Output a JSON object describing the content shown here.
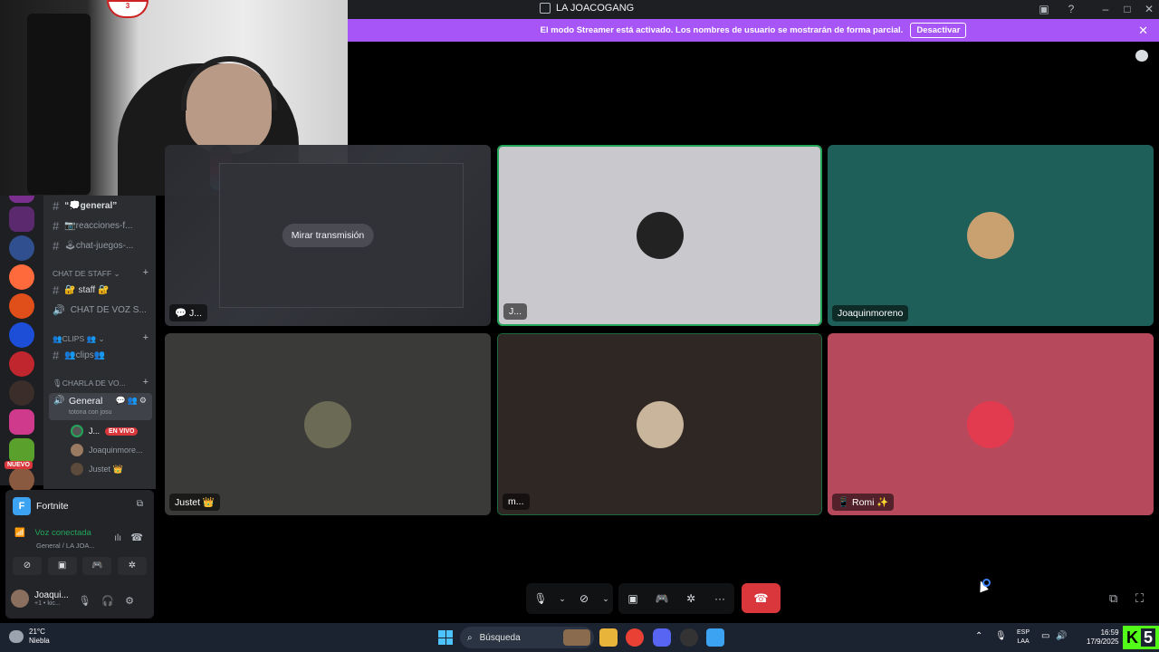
{
  "window": {
    "title": "LA JOACOGANG"
  },
  "banner": {
    "message": "El modo Streamer está activado. Los nombres de usuario se mostrarán de forma parcial.",
    "button": "Desactivar"
  },
  "webcam": {
    "logo_text": "3"
  },
  "channels": {
    "text": [
      {
        "label": "“💭general”"
      },
      {
        "label": "📷reacciones-f..."
      },
      {
        "label": "🕹chat-juegos-..."
      }
    ],
    "staff_category": "CHAT DE STAFF",
    "staff_channels": [
      {
        "label": "🔐 staff 🔐"
      },
      {
        "label": "CHAT DE VOZ S..."
      }
    ],
    "clips_category": "👥CLIPS 👥",
    "clips_channels": [
      {
        "label": "👥clips👥"
      }
    ],
    "voice_category": "🎙CHARLA DE VO...",
    "voice_channel": {
      "name": "General",
      "subtitle": "totona con josu"
    },
    "voice_users": [
      {
        "name": "J...",
        "badge": "EN VIVO"
      },
      {
        "name": "Joaquinmore..."
      },
      {
        "name": "Justet 👑"
      }
    ],
    "new_badge": "NUEVO"
  },
  "panel": {
    "game": "Fortnite",
    "voice_status": "Voz conectada",
    "voice_sub": "General / LA JOA...",
    "user_name": "Joaqui...",
    "user_status": "+1 • kic..."
  },
  "grid": {
    "stream_button": "Mirar transmisión",
    "tiles": [
      {
        "name": "J...",
        "bg": "#2e2f33"
      },
      {
        "name": "J...",
        "bg": "#c9c8cc"
      },
      {
        "name": "Joaquinmoreno",
        "bg": "#1f5f5a"
      },
      {
        "name": "Justet 👑",
        "bg": "#3a3a38"
      },
      {
        "name": "m...",
        "bg": "#2f2724"
      },
      {
        "name": "📱 Romi ✨",
        "bg": "#b64a5c"
      }
    ]
  },
  "taskbar": {
    "temp": "21°C",
    "weather": "Niebla",
    "search": "Búsqueda",
    "lang_top": "ESP",
    "lang_bottom": "LAA",
    "time": "16:59",
    "date": "17/9/2025",
    "kick_number": "5"
  },
  "colors": {
    "banner": "#a855f7",
    "hangup": "#da373c",
    "speaking_border": "#23a55a"
  }
}
